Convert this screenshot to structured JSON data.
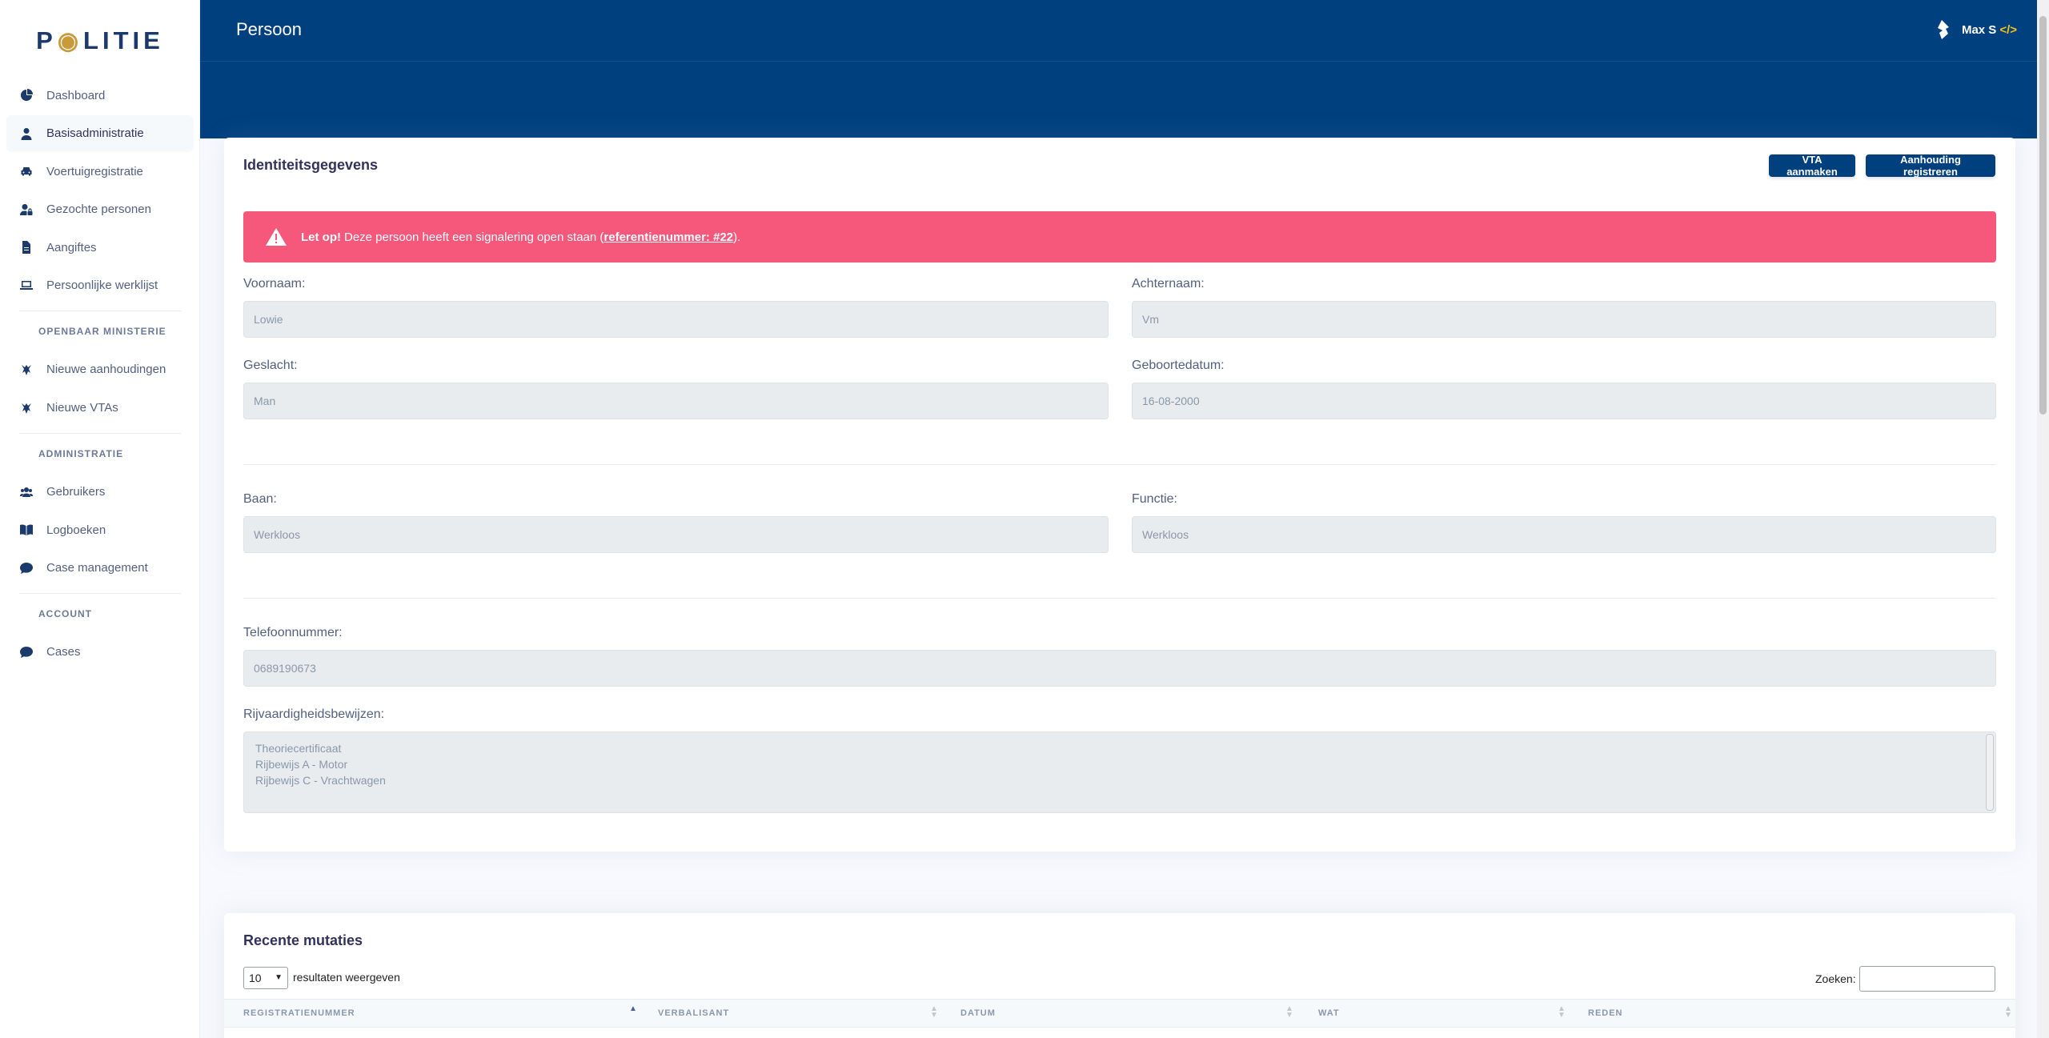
{
  "app": {
    "logo_text_left": "P",
    "logo_text_right": "LITIE"
  },
  "sidebar": {
    "items": [
      {
        "label": "Dashboard",
        "icon": "chart-pie-icon",
        "active": false
      },
      {
        "label": "Basisadministratie",
        "icon": "user-icon",
        "active": true
      },
      {
        "label": "Voertuigregistratie",
        "icon": "car-icon",
        "active": false
      },
      {
        "label": "Gezochte personen",
        "icon": "user-lock-icon",
        "active": false
      },
      {
        "label": "Aangiftes",
        "icon": "file-icon",
        "active": false
      },
      {
        "label": "Persoonlijke werklijst",
        "icon": "laptop-icon",
        "active": false
      }
    ],
    "heading_om": "OPENBAAR MINISTERIE",
    "om_items": [
      {
        "label": "Nieuwe aanhoudingen",
        "icon": "om-emblem-icon"
      },
      {
        "label": "Nieuwe VTAs",
        "icon": "om-emblem-icon"
      }
    ],
    "heading_admin": "ADMINISTRATIE",
    "admin_items": [
      {
        "label": "Gebruikers",
        "icon": "users-icon"
      },
      {
        "label": "Logboeken",
        "icon": "book-icon"
      },
      {
        "label": "Case management",
        "icon": "comment-icon"
      }
    ],
    "heading_account": "ACCOUNT",
    "account_items": [
      {
        "label": "Cases",
        "icon": "comment-icon"
      }
    ]
  },
  "header": {
    "title": "Persoon",
    "user_name": "Max S",
    "user_code_glyph": "</>"
  },
  "identity": {
    "title": "Identiteitsgegevens",
    "btn_vta": "VTA aanmaken",
    "btn_arrest": "Aanhouding registreren",
    "alert_prefix": "Let op!",
    "alert_text": "Deze persoon heeft een signalering open staan (",
    "alert_link": "referentienummer: #22",
    "alert_suffix": ").",
    "firstname_label": "Voornaam:",
    "firstname_value": "Lowie",
    "lastname_label": "Achternaam:",
    "lastname_value": "Vm",
    "gender_label": "Geslacht:",
    "gender_value": "Man",
    "dob_label": "Geboortedatum:",
    "dob_value": "16-08-2000",
    "job_label": "Baan:",
    "job_value": "Werkloos",
    "function_label": "Functie:",
    "function_value": "Werkloos",
    "phone_label": "Telefoonnummer:",
    "phone_value": "0689190673",
    "licenses_label": "Rijvaardigheidsbewijzen:",
    "licenses": [
      "Theoriecertificaat",
      "Rijbewijs A - Motor",
      "Rijbewijs C - Vrachtwagen"
    ]
  },
  "mutations": {
    "title": "Recente mutaties",
    "page_length": "10",
    "page_length_text": "resultaten weergeven",
    "search_label": "Zoeken:",
    "columns": [
      "REGISTRATIENUMMER",
      "VERBALISANT",
      "DATUM",
      "WAT",
      "REDEN"
    ]
  }
}
